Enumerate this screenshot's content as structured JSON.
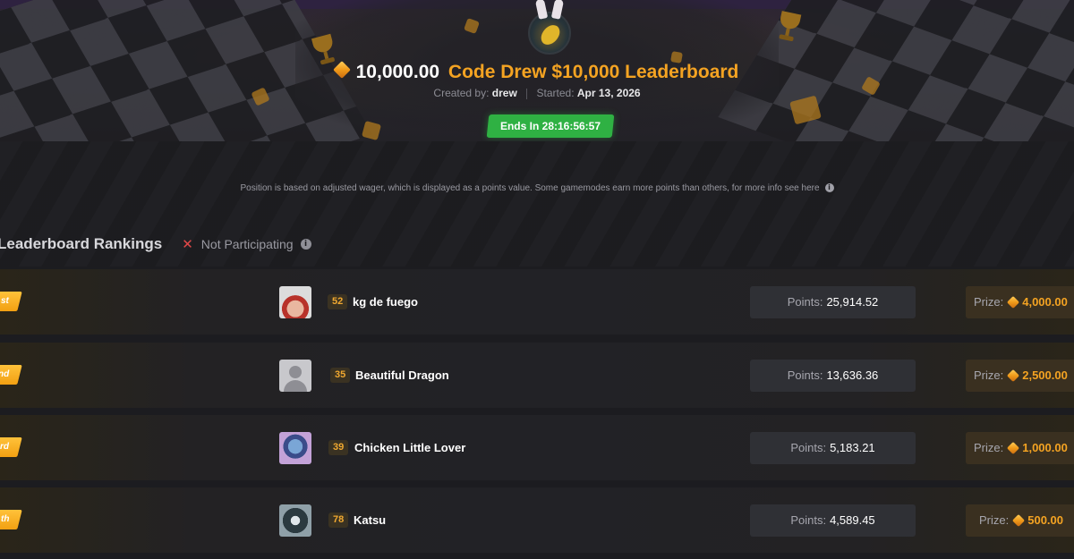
{
  "header": {
    "amount": "10,000.00",
    "title": "Code Drew $10,000 Leaderboard",
    "created_label": "Created by:",
    "creator": "drew",
    "started_label": "Started:",
    "started_date": "Apr 13, 2026",
    "ends_label": "Ends In 28:16:56:57",
    "accent_color": "#f4a322",
    "badge_color": "#2fb143"
  },
  "info": {
    "text": "Position is based on adjusted wager, which is displayed as a points value. Some gamemodes earn more points than others, for more info see here",
    "icon": "info-icon"
  },
  "rankings": {
    "title": "Leaderboard Rankings",
    "status_label": "Not Participating",
    "status_icon": "close-icon"
  },
  "rows": [
    {
      "place": "st",
      "level": "52",
      "username": "kg de fuego",
      "points_label": "Points:",
      "points": "25,914.52",
      "prize_label": "Prize:",
      "prize": "4,000.00"
    },
    {
      "place": "nd",
      "level": "35",
      "username": "Beautiful Dragon",
      "points_label": "Points:",
      "points": "13,636.36",
      "prize_label": "Prize:",
      "prize": "2,500.00"
    },
    {
      "place": "rd",
      "level": "39",
      "username": "Chicken Little Lover",
      "points_label": "Points:",
      "points": "5,183.21",
      "prize_label": "Prize:",
      "prize": "1,000.00"
    },
    {
      "place": "th",
      "level": "78",
      "username": "Katsu",
      "points_label": "Points:",
      "points": "4,589.45",
      "prize_label": "Prize:",
      "prize": "500.00"
    }
  ]
}
